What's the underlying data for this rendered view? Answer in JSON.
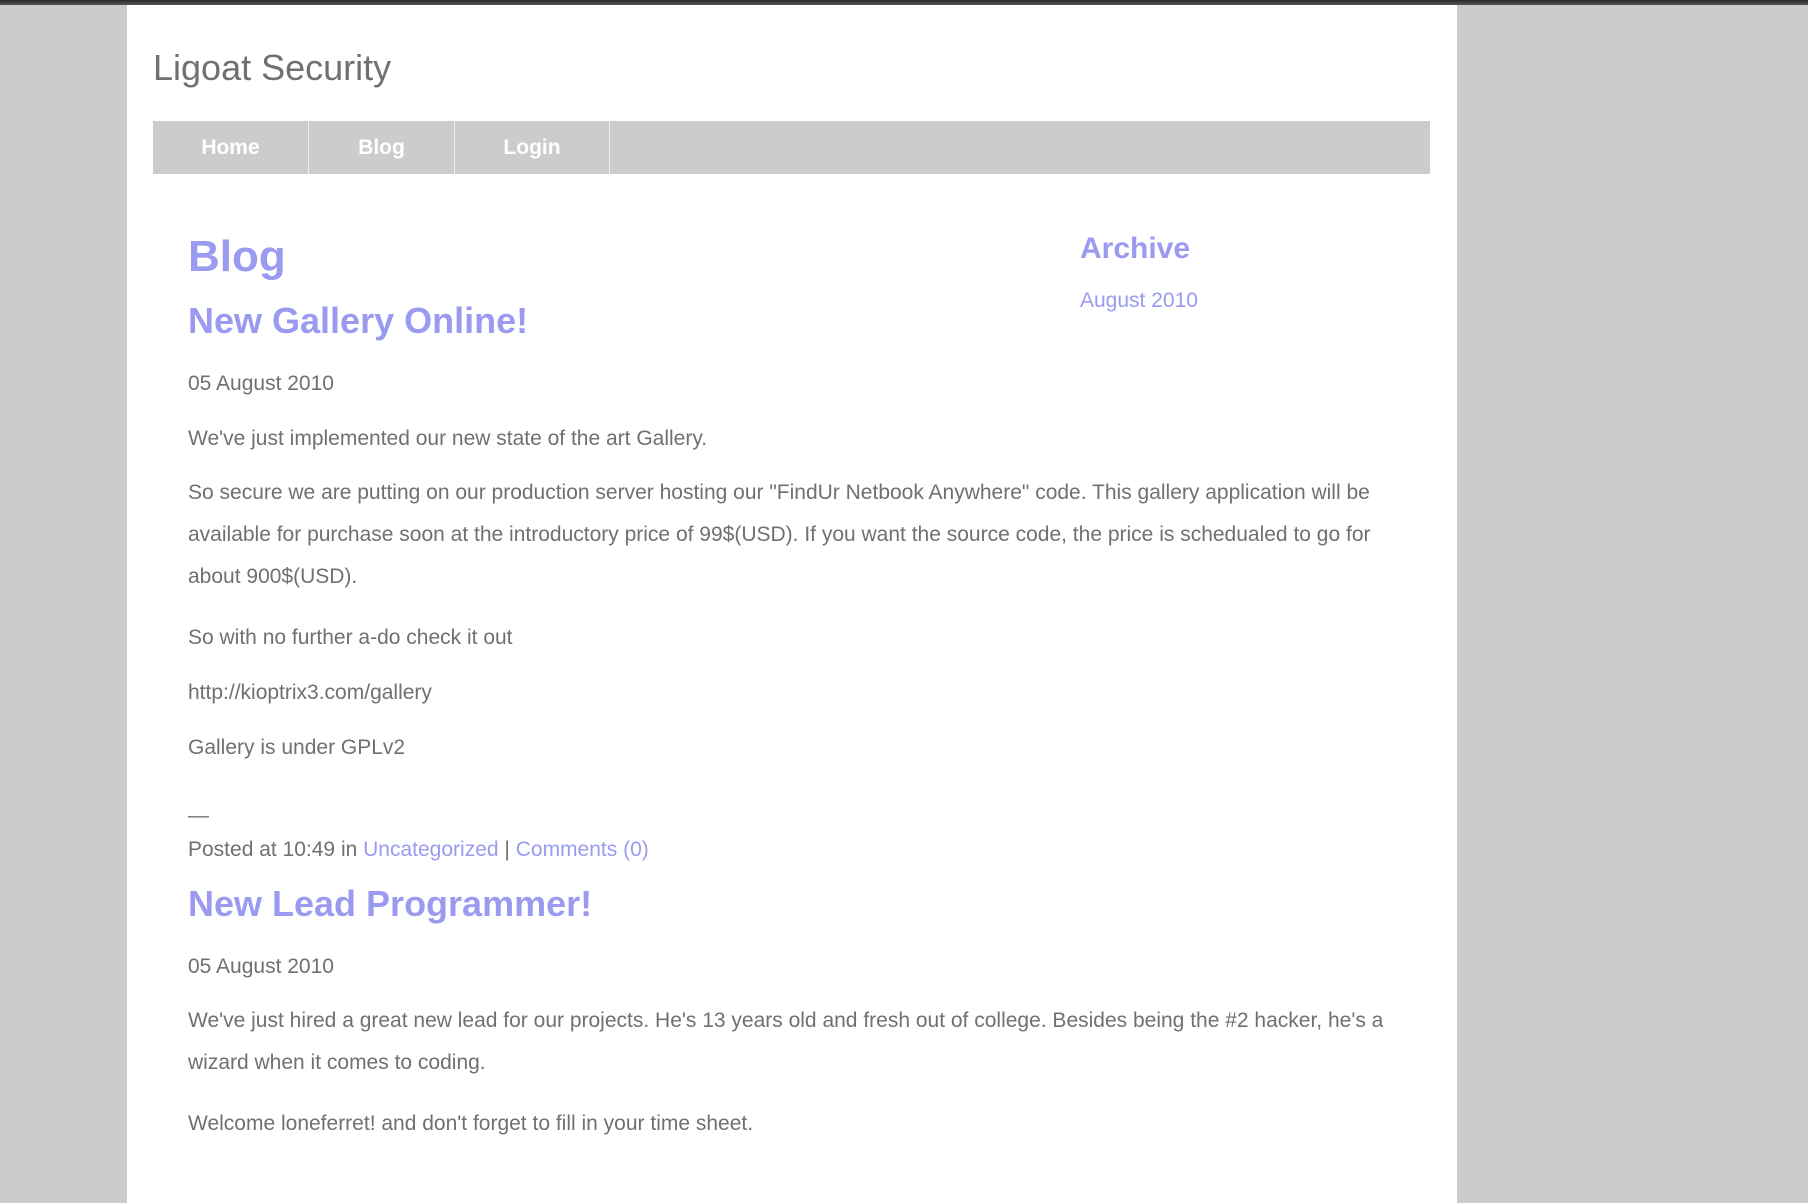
{
  "site": {
    "title": "Ligoat Security"
  },
  "nav": {
    "items": [
      {
        "label": "Home"
      },
      {
        "label": "Blog"
      },
      {
        "label": "Login"
      }
    ]
  },
  "main": {
    "heading": "Blog",
    "posts": [
      {
        "title": "New Gallery Online!",
        "date": "05 August 2010",
        "paragraphs": [
          "We've just implemented our new state of the art Gallery.",
          "So secure we are putting on our production server hosting our \"FindUr Netbook Anywhere\" code. This gallery application will be available for purchase soon at the introductory price of 99$(USD). If you want the source code, the price is schedualed to go for about 900$(USD).",
          "So with no further a-do check it out",
          "http://kioptrix3.com/gallery",
          "Gallery is under GPLv2"
        ],
        "separator": "—",
        "footer": {
          "prefix": "Posted at 10:49 in",
          "category": "Uncategorized",
          "divider": "|",
          "comments": "Comments (0)"
        }
      },
      {
        "title": "New Lead Programmer!",
        "date": "05 August 2010",
        "paragraphs": [
          "We've just hired a great new lead for our projects. He's 13 years old and fresh out of college. Besides being the #2 hacker, he's a wizard when it comes to coding.",
          "Welcome loneferret! and don't forget to fill in your time sheet."
        ]
      }
    ]
  },
  "sidebar": {
    "heading": "Archive",
    "links": [
      "August 2010"
    ]
  },
  "colors": {
    "accent": "#9a9af0",
    "text": "#707070",
    "nav_bg": "#cccccc",
    "page_bg": "#ffffff"
  }
}
